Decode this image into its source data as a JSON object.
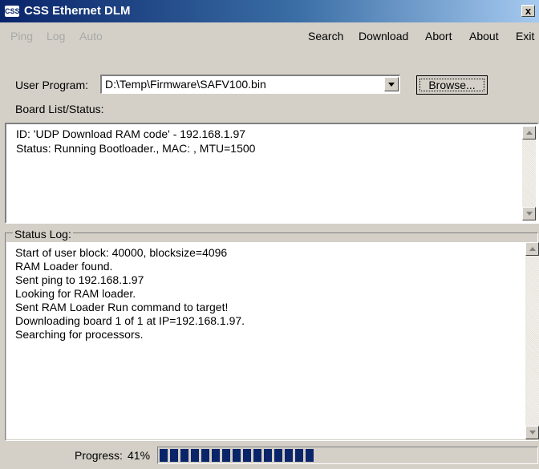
{
  "window": {
    "icon_text": "CSS",
    "title": "CSS Ethernet DLM",
    "close_label": "x"
  },
  "menu": {
    "disabled": [
      "Ping",
      "Log",
      "Auto"
    ],
    "items": [
      "Search",
      "Download",
      "Abort",
      "About",
      "Exit"
    ]
  },
  "user_program": {
    "label": "User Program:",
    "value": "D:\\Temp\\Firmware\\SAFV100.bin",
    "browse_label": "Browse..."
  },
  "board_list": {
    "label": "Board List/Status:",
    "lines": [
      "ID: 'UDP Download RAM code' - 192.168.1.97",
      "  Status: Running Bootloader., MAC: , MTU=1500"
    ]
  },
  "status_log": {
    "label": "Status Log:",
    "lines": [
      "Start of user block: 40000, blocksize=4096",
      "RAM Loader found.",
      "Sent ping to 192.168.1.97",
      "Looking for RAM loader.",
      "Sent RAM Loader Run command to target!",
      "Downloading board 1 of 1 at IP=192.168.1.97.",
      "Searching for processors."
    ]
  },
  "progress": {
    "label": "Progress:",
    "percent_text": "41%",
    "fraction": 0.41,
    "bar_color": "#0a246a"
  },
  "icons": {
    "window": "app-logo-icon",
    "close": "close-icon",
    "combo": "chevron-down-icon",
    "scroll_up": "arrow-up-icon",
    "scroll_down": "arrow-down-icon"
  },
  "colors": {
    "title_bar": "#0a246a",
    "window_bg": "#d4d0c8"
  }
}
